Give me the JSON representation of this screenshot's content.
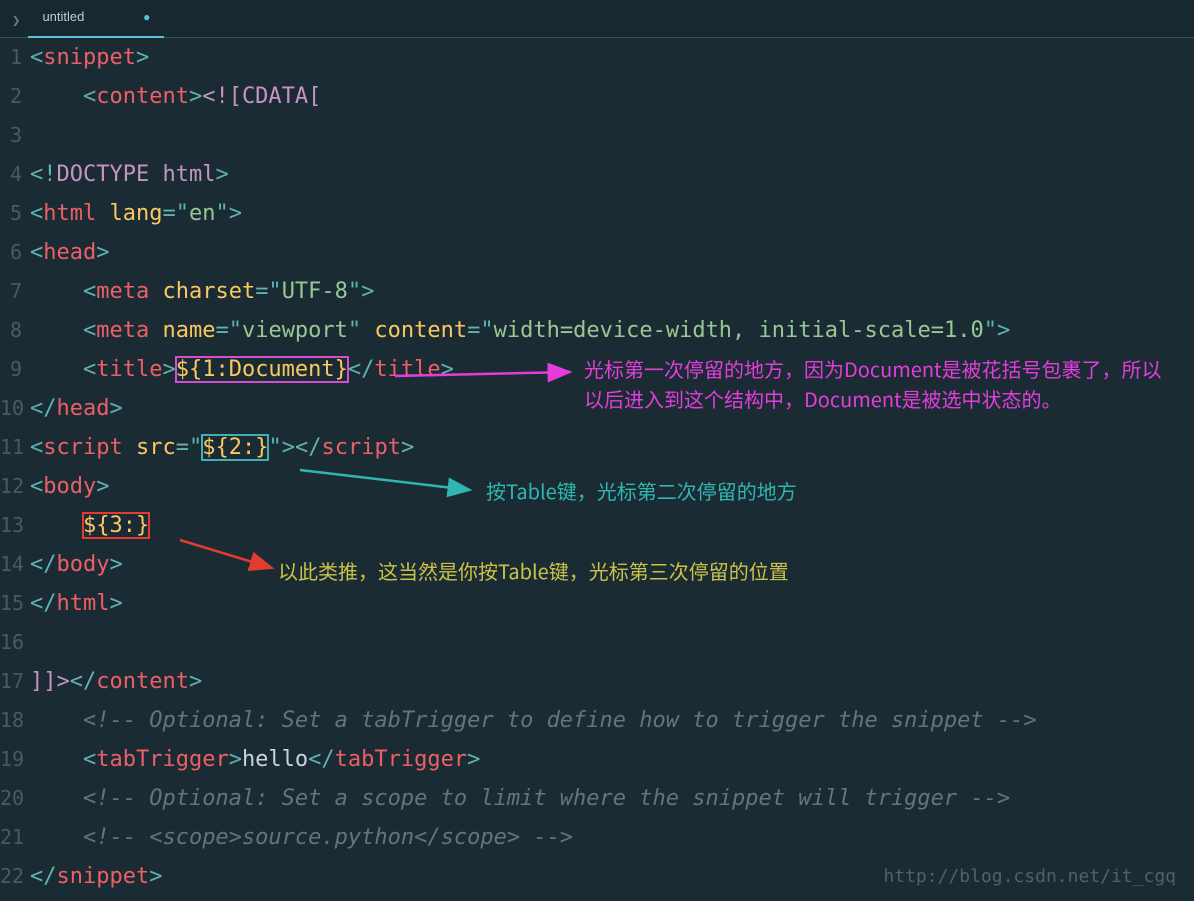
{
  "tab": {
    "title": "untitled",
    "dirty_glyph": "●"
  },
  "gutter": [
    "1",
    "2",
    "3",
    "4",
    "5",
    "6",
    "7",
    "8",
    "9",
    "10",
    "11",
    "12",
    "13",
    "14",
    "15",
    "16",
    "17",
    "18",
    "19",
    "20",
    "21",
    "22"
  ],
  "code": {
    "l1": {
      "open": "<",
      "tag": "snippet",
      "close": ">"
    },
    "l2": {
      "indent": "    ",
      "open": "<",
      "tag": "content",
      "close": ">",
      "cdata": "<![CDATA["
    },
    "l4": {
      "open": "<!",
      "kw": "DOCTYPE html",
      "close": ">"
    },
    "l5": {
      "open": "<",
      "tag": "html",
      "sp": " ",
      "attr": "lang",
      "eq": "=\"",
      "val": "en",
      "endq": "\"",
      "close": ">"
    },
    "l6": {
      "open": "<",
      "tag": "head",
      "close": ">"
    },
    "l7": {
      "indent": "    ",
      "open": "<",
      "tag": "meta",
      "sp": " ",
      "attr": "charset",
      "eq": "=\"",
      "val": "UTF-8",
      "endq": "\"",
      "close": ">"
    },
    "l8": {
      "indent": "    ",
      "open": "<",
      "tag": "meta",
      "sp": " ",
      "attr1": "name",
      "eq1": "=\"",
      "val1": "viewport",
      "q1": "\" ",
      "attr2": "content",
      "eq2": "=\"",
      "val2": "width=device-width, initial-scale=1.0",
      "q2": "\"",
      "close": ">"
    },
    "l9": {
      "indent": "    ",
      "open": "<",
      "tag": "title",
      "close": ">",
      "var": "${1:Document}",
      "open2": "</",
      "tag2": "title",
      "close2": ">"
    },
    "l10": {
      "open": "</",
      "tag": "head",
      "close": ">"
    },
    "l11": {
      "open": "<",
      "tag": "script",
      "sp": " ",
      "attr": "src",
      "eq": "=\"",
      "var": "${2:}",
      "endq": "\"",
      "close": ">",
      "open2": "</",
      "tag2": "script",
      "close2": ">"
    },
    "l12": {
      "open": "<",
      "tag": "body",
      "close": ">"
    },
    "l13": {
      "indent": "    ",
      "var": "${3:}"
    },
    "l14": {
      "open": "</",
      "tag": "body",
      "close": ">"
    },
    "l15": {
      "open": "</",
      "tag": "html",
      "close": ">"
    },
    "l17": {
      "cdata": "]]>",
      "open": "</",
      "tag": "content",
      "close": ">"
    },
    "l18": {
      "indent": "    ",
      "cmt": "<!-- Optional: Set a tabTrigger to define how to trigger the snippet -->"
    },
    "l19": {
      "indent": "    ",
      "open": "<",
      "tag": "tabTrigger",
      "close": ">",
      "txt": "hello",
      "open2": "</",
      "tag2": "tabTrigger",
      "close2": ">"
    },
    "l20": {
      "indent": "    ",
      "cmt": "<!-- Optional: Set a scope to limit where the snippet will trigger -->"
    },
    "l21": {
      "indent": "    ",
      "cmt": "<!-- <scope>source.python</scope> -->"
    },
    "l22": {
      "open": "</",
      "tag": "snippet",
      "close": ">"
    }
  },
  "annotations": {
    "a1": "光标第一次停留的地方，因为Document是被花括号包裹了，所以以后进入到这个结构中，Document是被选中状态的。",
    "a2": "按Table键，光标第二次停留的地方",
    "a3": "以此类推，这当然是你按Table键，光标第三次停留的位置"
  },
  "watermark": "http://blog.csdn.net/it_cgq",
  "colors": {
    "bg": "#1b2b34",
    "tag": "#ec5f67",
    "punc": "#5fb3b3",
    "str": "#99c794",
    "attr": "#c594c5",
    "attr2": "#fac863",
    "cmt": "#65737e"
  }
}
